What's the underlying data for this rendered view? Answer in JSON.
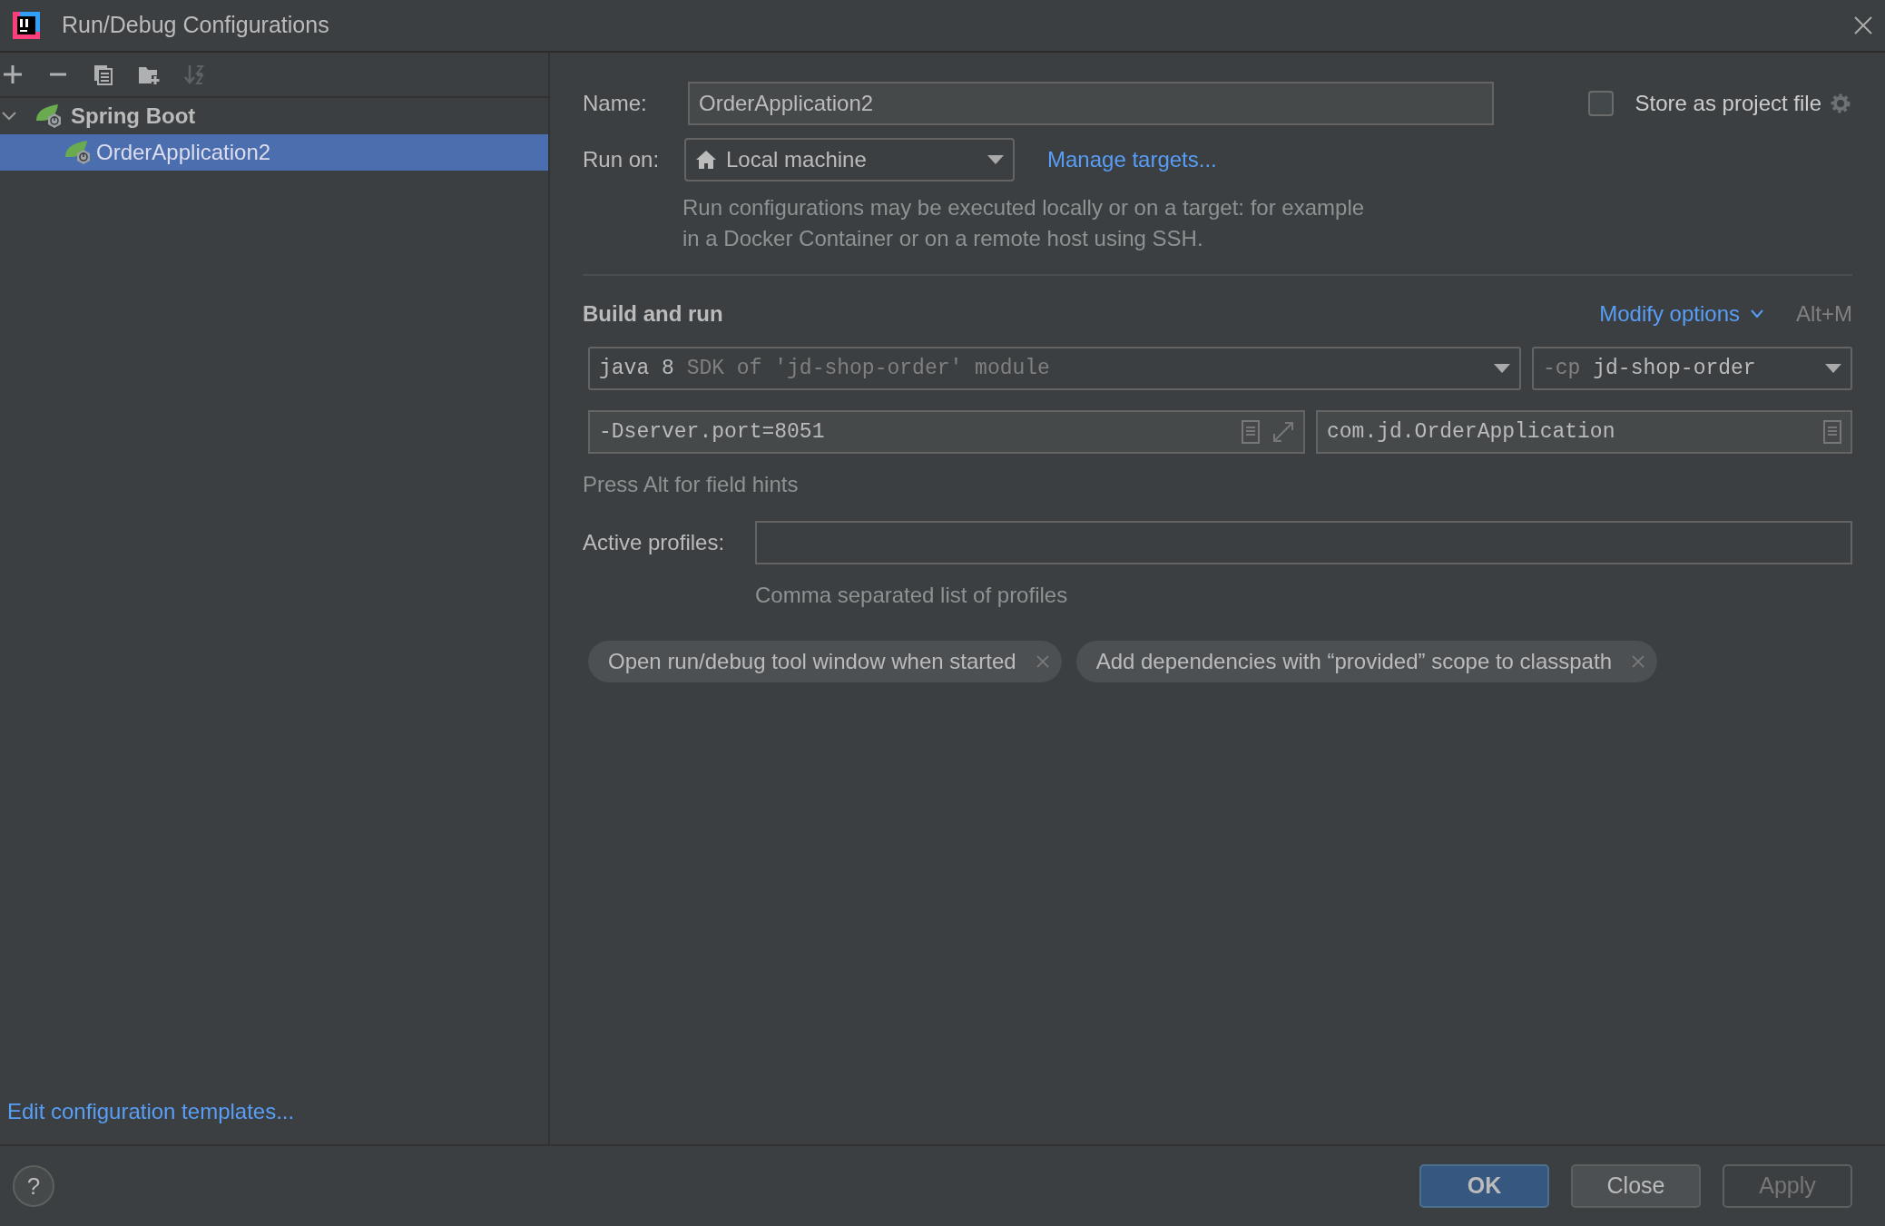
{
  "window": {
    "title": "Run/Debug Configurations"
  },
  "toolbar": [
    {
      "kind": "add",
      "disabled": false
    },
    {
      "kind": "remove",
      "disabled": false
    },
    {
      "kind": "copy",
      "disabled": false
    },
    {
      "kind": "folder",
      "disabled": false
    },
    {
      "kind": "sort",
      "disabled": true
    }
  ],
  "tree": [
    {
      "label": "Spring Boot",
      "expanded": true,
      "selected": false,
      "children": [
        {
          "label": "OrderApplication2",
          "selected": true
        }
      ]
    }
  ],
  "edit_templates_link": "Edit configuration templates...",
  "form": {
    "name_label": "Name:",
    "name_value": "OrderApplication2",
    "store_as_project_file": {
      "label": "Store as project file",
      "checked": false
    },
    "run_on_label": "Run on:",
    "run_on_value": "Local machine",
    "manage_targets": "Manage targets...",
    "run_on_hint": "Run configurations may be executed locally or on a target: for example in a Docker Container or on a remote host using SSH.",
    "section_title": "Build and run",
    "modify_options": "Modify options",
    "modify_shortcut": "Alt+M",
    "jre": {
      "value": "java 8",
      "hint": "SDK of 'jd-shop-order' module"
    },
    "classpath": {
      "prefix": "-cp",
      "value": "jd-shop-order"
    },
    "vm_options": "-Dserver.port=8051",
    "main_class": "com.jd.OrderApplication",
    "field_hints": "Press Alt for field hints",
    "active_profiles_label": "Active profiles:",
    "active_profiles_hint": "Comma separated list of profiles",
    "chips": [
      "Open run/debug tool window when started",
      "Add dependencies with “provided” scope to classpath"
    ]
  },
  "footer": {
    "help": "?",
    "buttons": [
      {
        "label": "OK",
        "default": true,
        "disabled": false
      },
      {
        "label": "Close",
        "default": false,
        "disabled": false
      },
      {
        "label": "Apply",
        "default": false,
        "disabled": true
      }
    ]
  }
}
